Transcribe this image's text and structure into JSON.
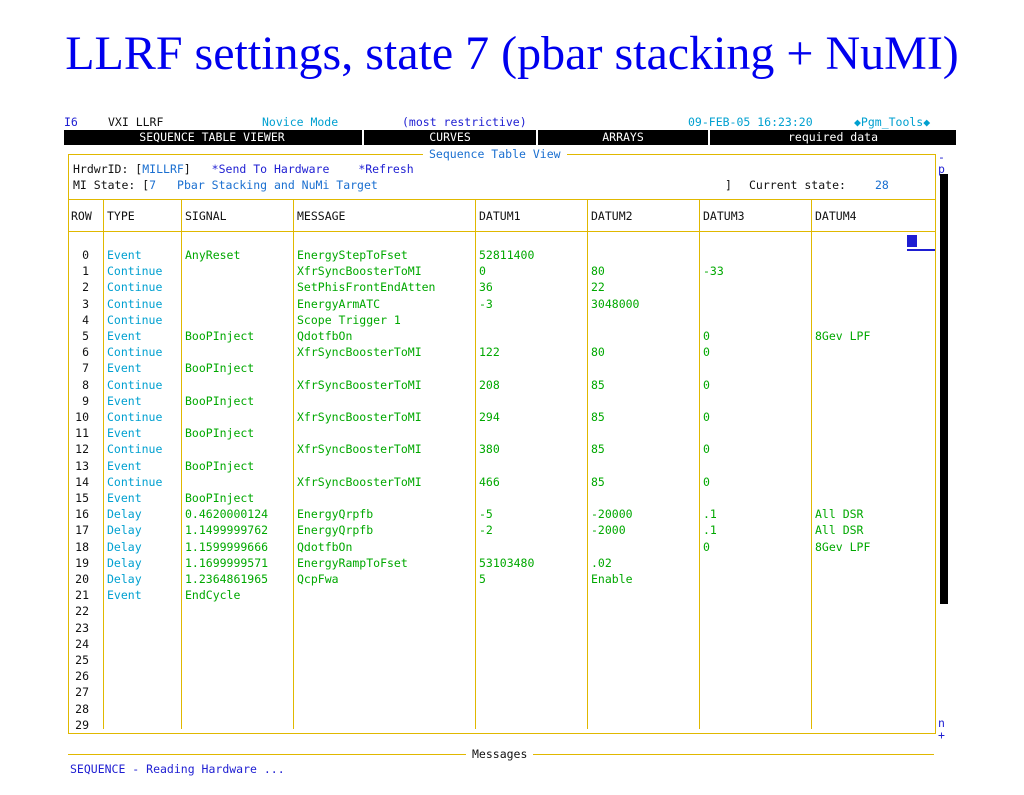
{
  "slide_title": "LLRF settings, state 7 (pbar stacking + NuMI)",
  "topbar": {
    "console_id": "I6",
    "app_name": "VXI LLRF",
    "mode": "Novice Mode",
    "mode_note": "(most restrictive)",
    "datetime": "09-FEB-05 16:23:20",
    "pgm_tools": "◆Pgm_Tools◆"
  },
  "menu": [
    "SEQUENCE TABLE VIEWER",
    "CURVES",
    "ARRAYS",
    "required data"
  ],
  "panel": {
    "title": "Sequence Table View",
    "hrdwr_label": "HrdwrID: [",
    "hrdwr_value": "MILLRF",
    "hrdwr_close": "]",
    "send_hw": "*Send To Hardware",
    "refresh": "*Refresh",
    "mi_label": "MI State: [",
    "mi_value": "7",
    "mi_desc": "Pbar Stacking and NuMi Target",
    "mi_close": "]",
    "current_label": "Current state:",
    "current_value": "28"
  },
  "columns": [
    "ROW",
    "TYPE",
    "SIGNAL",
    "MESSAGE",
    "DATUM1",
    "DATUM2",
    "DATUM3",
    "DATUM4"
  ],
  "rows": [
    [
      "0",
      "Event",
      "AnyReset",
      "EnergyStepToFset",
      "52811400",
      "",
      "",
      ""
    ],
    [
      "1",
      "Continue",
      "",
      "XfrSyncBoosterToMI",
      "0",
      "80",
      "-33",
      ""
    ],
    [
      "2",
      "Continue",
      "",
      "SetPhisFrontEndAtten",
      "36",
      "22",
      "",
      ""
    ],
    [
      "3",
      "Continue",
      "",
      "EnergyArmATC",
      "-3",
      "3048000",
      "",
      ""
    ],
    [
      "4",
      "Continue",
      "",
      "Scope Trigger 1",
      "",
      "",
      "",
      ""
    ],
    [
      "5",
      "Event",
      "BooPInject",
      "QdotfbOn",
      "",
      "",
      "0",
      "8Gev LPF"
    ],
    [
      "6",
      "Continue",
      "",
      "XfrSyncBoosterToMI",
      "122",
      "80",
      "0",
      ""
    ],
    [
      "7",
      "Event",
      "BooPInject",
      "",
      "",
      "",
      "",
      ""
    ],
    [
      "8",
      "Continue",
      "",
      "XfrSyncBoosterToMI",
      "208",
      "85",
      "0",
      ""
    ],
    [
      "9",
      "Event",
      "BooPInject",
      "",
      "",
      "",
      "",
      ""
    ],
    [
      "10",
      "Continue",
      "",
      "XfrSyncBoosterToMI",
      "294",
      "85",
      "0",
      ""
    ],
    [
      "11",
      "Event",
      "BooPInject",
      "",
      "",
      "",
      "",
      ""
    ],
    [
      "12",
      "Continue",
      "",
      "XfrSyncBoosterToMI",
      "380",
      "85",
      "0",
      ""
    ],
    [
      "13",
      "Event",
      "BooPInject",
      "",
      "",
      "",
      "",
      ""
    ],
    [
      "14",
      "Continue",
      "",
      "XfrSyncBoosterToMI",
      "466",
      "85",
      "0",
      ""
    ],
    [
      "15",
      "Event",
      "BooPInject",
      "",
      "",
      "",
      "",
      ""
    ],
    [
      "16",
      "Delay",
      "0.4620000124",
      "EnergyQrpfb",
      "-5",
      "-20000",
      ".1",
      "All DSR"
    ],
    [
      "17",
      "Delay",
      "1.1499999762",
      "EnergyQrpfb",
      "-2",
      "-2000",
      ".1",
      "All DSR"
    ],
    [
      "18",
      "Delay",
      "1.1599999666",
      "QdotfbOn",
      "",
      "",
      "0",
      "8Gev LPF"
    ],
    [
      "19",
      "Delay",
      "1.1699999571",
      "EnergyRampToFset",
      "53103480",
      ".02",
      "",
      ""
    ],
    [
      "20",
      "Delay",
      "1.2364861965",
      "QcpFwa",
      "5",
      "Enable",
      "",
      ""
    ],
    [
      "21",
      "Event",
      "EndCycle",
      "",
      "",
      "",
      "",
      ""
    ],
    [
      "22",
      "",
      "",
      "",
      "",
      "",
      "",
      ""
    ],
    [
      "23",
      "",
      "",
      "",
      "",
      "",
      "",
      ""
    ],
    [
      "24",
      "",
      "",
      "",
      "",
      "",
      "",
      ""
    ],
    [
      "25",
      "",
      "",
      "",
      "",
      "",
      "",
      ""
    ],
    [
      "26",
      "",
      "",
      "",
      "",
      "",
      "",
      ""
    ],
    [
      "27",
      "",
      "",
      "",
      "",
      "",
      "",
      ""
    ],
    [
      "28",
      "",
      "",
      "",
      "",
      "",
      "",
      ""
    ],
    [
      "29",
      "",
      "",
      "",
      "",
      "",
      "",
      ""
    ]
  ],
  "scroll": {
    "up": "-",
    "p": "p",
    "n": "n",
    "down": "+"
  },
  "messages": {
    "title": "Messages",
    "text": "SEQUENCE - Reading Hardware ..."
  }
}
